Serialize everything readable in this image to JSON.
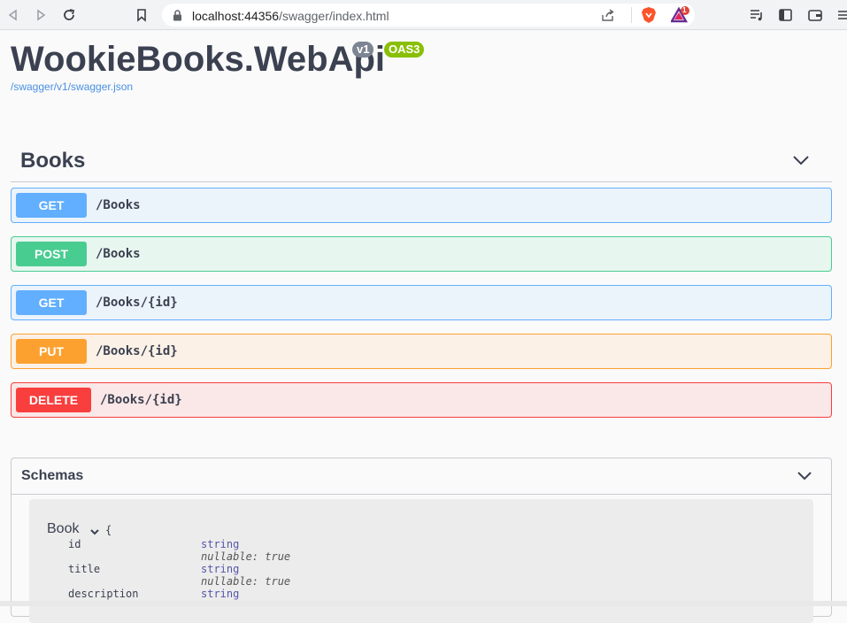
{
  "browser": {
    "url_host": "localhost:44356",
    "url_path": "/swagger/index.html",
    "brave_badge_count": "1"
  },
  "page": {
    "title": "WookieBooks.WebApi",
    "version_badge": "v1",
    "oas_badge": "OAS3",
    "spec_link": "/swagger/v1/swagger.json"
  },
  "tag": {
    "name": "Books",
    "operations": [
      {
        "method": "GET",
        "path": "/Books"
      },
      {
        "method": "POST",
        "path": "/Books"
      },
      {
        "method": "GET",
        "path": "/Books/{id}"
      },
      {
        "method": "PUT",
        "path": "/Books/{id}"
      },
      {
        "method": "DELETE",
        "path": "/Books/{id}"
      }
    ]
  },
  "schemas": {
    "title": "Schemas",
    "model": {
      "name": "Book",
      "open_brace": "{",
      "properties": [
        {
          "name": "id",
          "type": "string",
          "meta": "nullable: true"
        },
        {
          "name": "title",
          "type": "string",
          "meta": "nullable: true"
        },
        {
          "name": "description",
          "type": "string"
        }
      ]
    }
  },
  "colors": {
    "get": "#61affe",
    "post": "#49cc90",
    "put": "#fca130",
    "delete": "#f93e3e",
    "oas_badge": "#89bf04",
    "version_badge": "#7d8492"
  }
}
